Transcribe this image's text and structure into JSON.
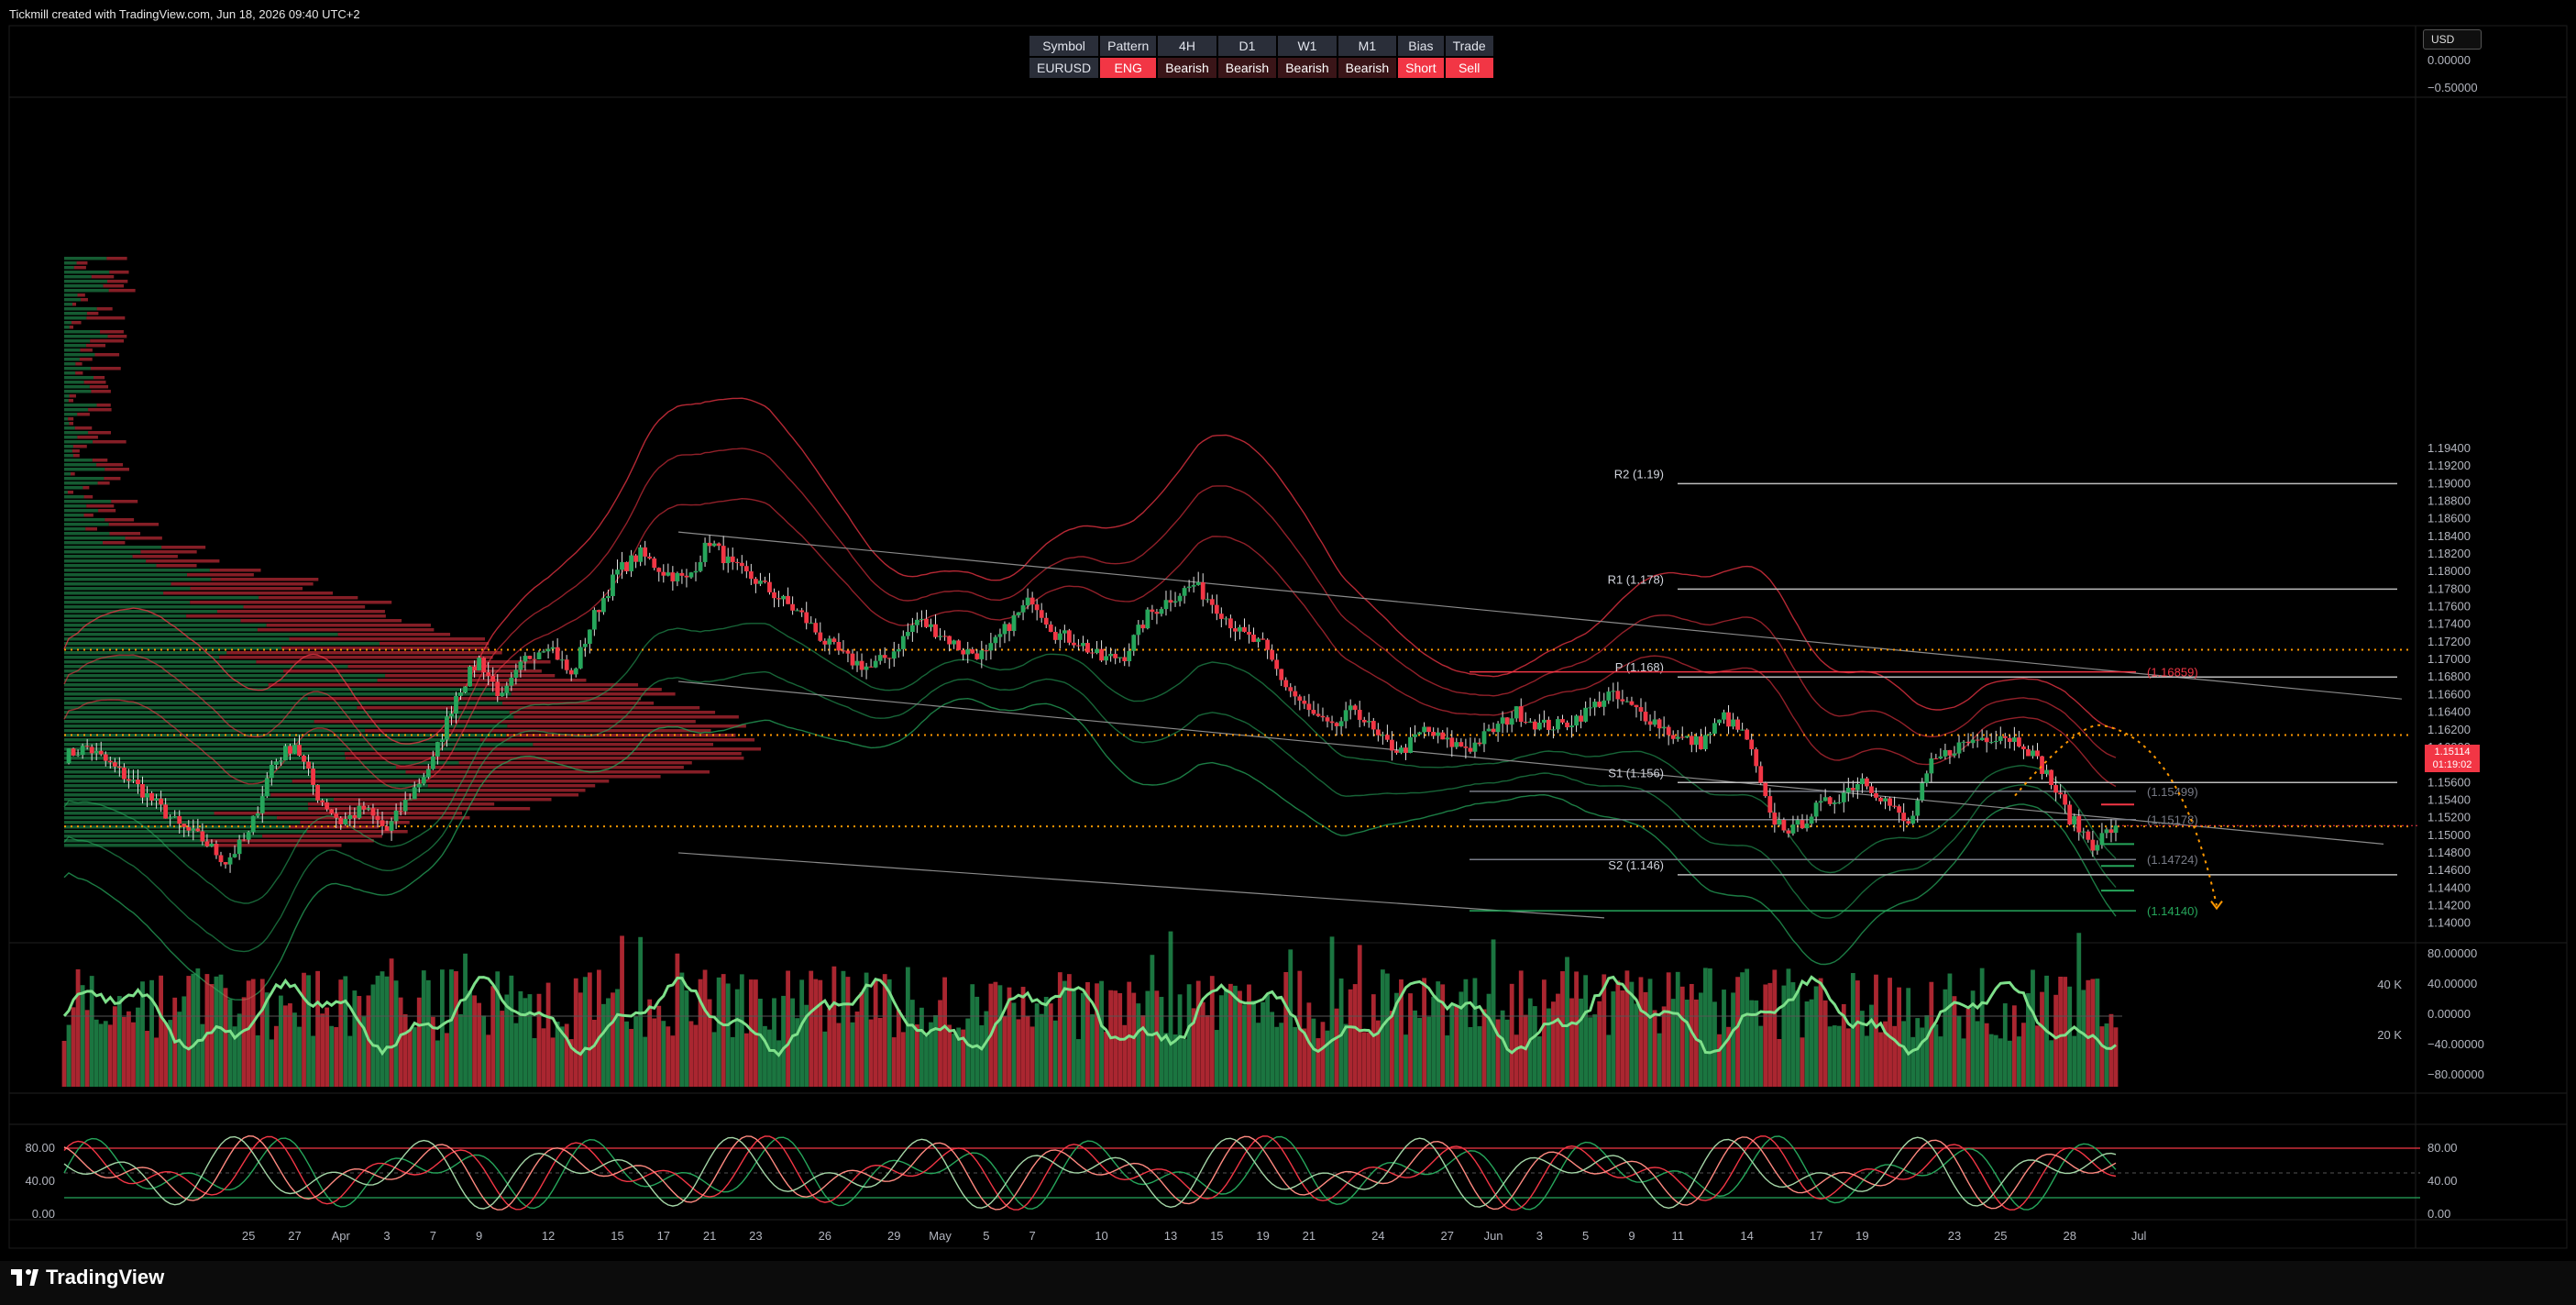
{
  "header": {
    "caption": "Tickmill created with TradingView.com, Jun 18, 2026 09:40 UTC+2"
  },
  "footer": {
    "logo_text": "TradingView"
  },
  "currency_button": "USD",
  "signal_table": {
    "headers": [
      "Symbol",
      "Pattern",
      "4H",
      "D1",
      "W1",
      "M1",
      "Bias",
      "Trade"
    ],
    "values": [
      "EURUSD",
      "ENG",
      "Bearish",
      "Bearish",
      "Bearish",
      "Bearish",
      "Short",
      "Sell"
    ]
  },
  "colors": {
    "bull": "#26a65b",
    "bear": "#f23645",
    "background": "#000000",
    "grid_line": "#2a2a2a",
    "level_line": "#8c8c8c",
    "orange": "#ff9800"
  },
  "chart_data": [
    {
      "type": "candlestick",
      "title": "EURUSD",
      "ylim": [
        1.139,
        1.195
      ],
      "y_ticks": [
        "1.19400",
        "1.19200",
        "1.19000",
        "1.18800",
        "1.18600",
        "1.18400",
        "1.18200",
        "1.18000",
        "1.17800",
        "1.17600",
        "1.17400",
        "1.17200",
        "1.17000",
        "1.16800",
        "1.16600",
        "1.16400",
        "1.16200",
        "1.16000",
        "1.15800",
        "1.15600",
        "1.15400",
        "1.15200",
        "1.15000",
        "1.14800",
        "1.14600",
        "1.14400",
        "1.14200",
        "1.14000"
      ],
      "top_pane_ticks": [
        "0.00000",
        "−0.50000"
      ],
      "x_ticks": [
        "25",
        "27",
        "Apr",
        "3",
        "7",
        "9",
        "12",
        "15",
        "17",
        "21",
        "23",
        "26",
        "29",
        "May",
        "5",
        "7",
        "10",
        "13",
        "15",
        "19",
        "21",
        "24",
        "27",
        "Jun",
        "3",
        "5",
        "9",
        "11",
        "14",
        "17",
        "19",
        "23",
        "25",
        "28",
        "Jul"
      ],
      "x_tick_values": [
        8,
        10,
        12,
        14,
        16,
        18,
        21,
        24,
        26,
        28,
        30,
        33,
        36,
        38,
        40,
        42,
        45,
        48,
        50,
        52,
        54,
        57,
        60,
        62,
        64,
        66,
        68,
        70,
        73,
        76,
        78,
        82,
        84,
        87,
        90
      ],
      "close_series": [
        1.159,
        1.16,
        1.158,
        1.156,
        1.1535,
        1.151,
        1.1495,
        1.147,
        1.15,
        1.158,
        1.1605,
        1.1545,
        1.1515,
        1.153,
        1.1505,
        1.1545,
        1.1585,
        1.166,
        1.17,
        1.1655,
        1.17,
        1.172,
        1.168,
        1.175,
        1.18,
        1.182,
        1.18,
        1.179,
        1.1835,
        1.1805,
        1.179,
        1.177,
        1.175,
        1.172,
        1.17,
        1.169,
        1.171,
        1.1745,
        1.173,
        1.171,
        1.1705,
        1.174,
        1.177,
        1.173,
        1.172,
        1.17,
        1.1705,
        1.175,
        1.177,
        1.1785,
        1.176,
        1.173,
        1.1715,
        1.167,
        1.164,
        1.162,
        1.1645,
        1.161,
        1.1595,
        1.162,
        1.1605,
        1.16,
        1.162,
        1.164,
        1.1625,
        1.1625,
        1.164,
        1.166,
        1.1645,
        1.163,
        1.161,
        1.1605,
        1.1635,
        1.161,
        1.152,
        1.1505,
        1.153,
        1.1545,
        1.1565,
        1.154,
        1.151,
        1.158,
        1.16,
        1.161,
        1.1615,
        1.1605,
        1.157,
        1.152,
        1.149,
        1.1511
      ],
      "current_price": "1.15114",
      "countdown": "01:19:02",
      "levels": [
        {
          "label": "R2 (1.19)",
          "value": 1.19
        },
        {
          "label": "R1 (1.178)",
          "value": 1.178
        },
        {
          "label": "P (1.168)",
          "value": 1.168
        },
        {
          "label": "S1 (1.156)",
          "value": 1.156
        },
        {
          "label": "S2 (1.146)",
          "value": 1.1455
        }
      ],
      "zone_labels": [
        {
          "label": "(1.16859)",
          "value": 1.16859,
          "color": "#f23645"
        },
        {
          "label": "(1.15499)",
          "value": 1.15499,
          "color": "#787b86"
        },
        {
          "label": "(1.15178)",
          "value": 1.15178,
          "color": "#787b86"
        },
        {
          "label": "(1.14724)",
          "value": 1.14724,
          "color": "#787b86"
        },
        {
          "label": "(1.14140)",
          "value": 1.1414,
          "color": "#26a65b"
        }
      ],
      "dotted_levels": [
        1.1711,
        1.1614,
        1.151
      ]
    },
    {
      "type": "bar",
      "title": "Volume",
      "y_ticks_right": [
        "80.00000",
        "40.00000",
        "0.00000",
        "−40.00000",
        "−80.00000"
      ],
      "y_ticks_left": [
        "40 K",
        "20 K"
      ]
    },
    {
      "type": "line",
      "title": "Stochastic",
      "ylim": [
        0,
        100
      ],
      "y_ticks": [
        "80.00",
        "40.00",
        "0.00"
      ]
    }
  ]
}
